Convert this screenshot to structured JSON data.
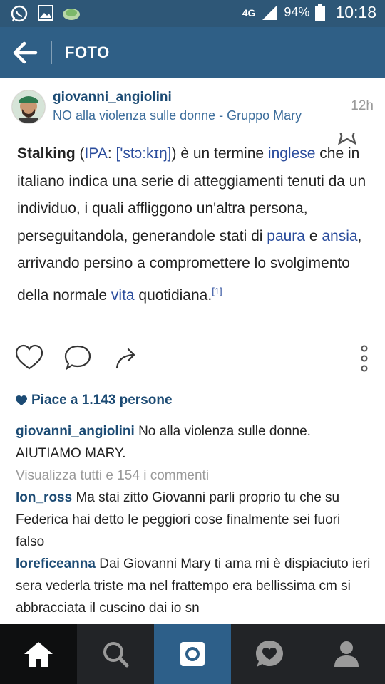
{
  "status_bar": {
    "network": "4G",
    "battery": "94%",
    "time": "10:18",
    "icons": [
      "whatsapp-icon",
      "gallery-icon",
      "cloud-icon",
      "signal-icon",
      "battery-icon"
    ]
  },
  "app_bar": {
    "title": "FOTO",
    "back_icon": "arrow-left-icon"
  },
  "post_header": {
    "username": "giovanni_angiolini",
    "subtitle": "NO alla violenza sulle donne - Gruppo Mary",
    "time_ago": "12h"
  },
  "post_text": {
    "t1": "Stalking",
    "t2": " (",
    "t3": "IPA",
    "t4": ": ",
    "t5": "['stɔːkɪŋ]",
    "t6": ") è un termine ",
    "t7": "inglese",
    "t8": " che in italiano indica una serie di atteggiamenti tenuti da un individuo, i quali affliggono un'altra persona, perseguitandola, generandole stati di ",
    "t9": "paura",
    "t10": " e ",
    "t11": "ansia",
    "t12": ", arrivando persino a compromettere lo svolgimento della normale ",
    "t13": "vita",
    "t14": " quotidiana.",
    "ref": "[1]"
  },
  "likes": {
    "text": "Piace a 1.143 persone"
  },
  "caption": {
    "user": "giovanni_angiolini",
    "text": " No alla violenza sulle donne. AIUTIAMO MARY."
  },
  "view_all": "Visualizza tutti e 154 i commenti",
  "comments": [
    {
      "user": "lon_ross",
      "text": " Ma stai zitto Giovanni parli proprio tu che su Federica hai detto le peggiori cose finalmente sei fuori falso"
    },
    {
      "user": "loreficeanna",
      "text": " Dai Giovanni Mary ti ama mi è dispiaciuto ieri sera vederla triste ma nel frattempo era bellissima cm si abbracciata il cuscino dai io sn"
    }
  ],
  "nav": [
    "home-icon",
    "search-icon",
    "camera-icon",
    "heart-bubble-icon",
    "profile-icon"
  ],
  "colors": {
    "status_bar": "#2e5777",
    "app_bar": "#2f5f86",
    "link": "#1c4b74",
    "nav_bg": "#222427",
    "nav_active": "#2d5f89"
  }
}
